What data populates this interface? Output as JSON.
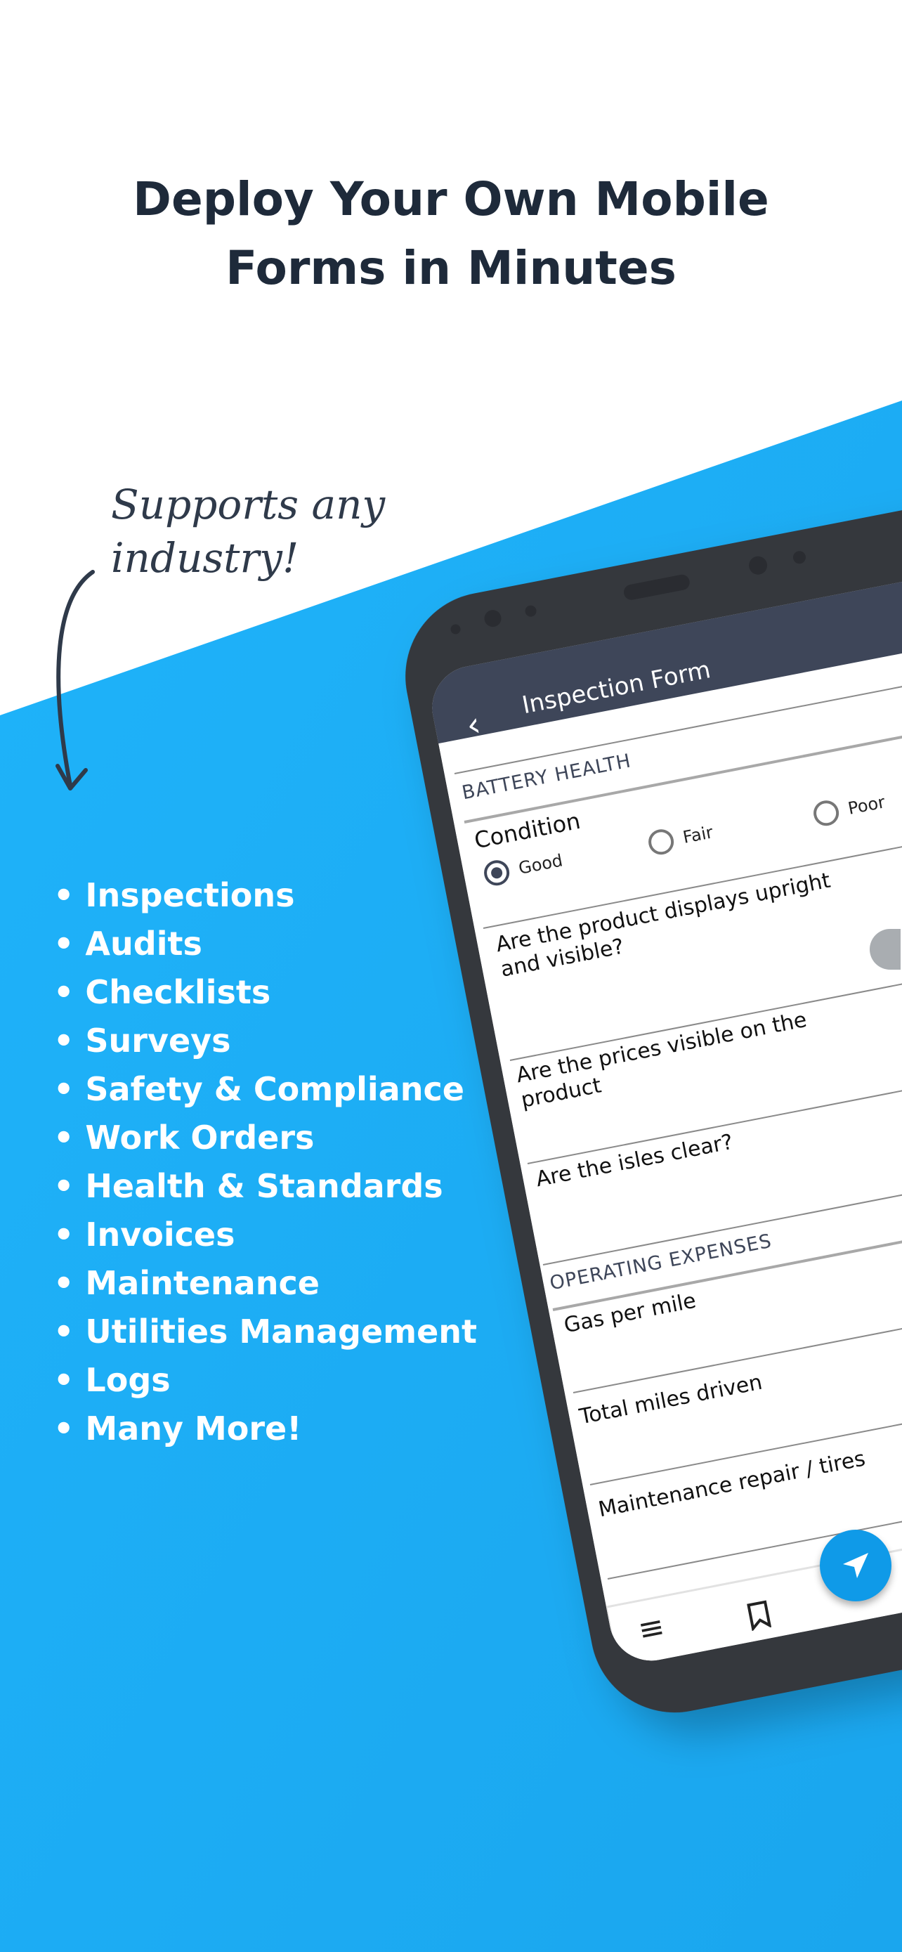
{
  "colors": {
    "accent_blue": "#1fb0f8",
    "headline": "#1e2a3a",
    "app_bar": "#3e4659",
    "fab": "#0f9ae8"
  },
  "headline": {
    "line1": "Deploy Your Own Mobile",
    "line2": "Forms in Minutes"
  },
  "callout": {
    "line1": "Supports any",
    "line2": "industry!"
  },
  "industries": [
    "• Inspections",
    "• Audits",
    "• Checklists",
    "• Surveys",
    "• Safety & Compliance",
    "• Work Orders",
    "• Health & Standards",
    "• Invoices",
    "• Maintenance",
    "• Utilities Management",
    "• Logs",
    "• Many More!"
  ],
  "app": {
    "title": "Inspection Form",
    "back_icon": "chevron-left-icon",
    "sections": [
      {
        "title": "BATTERY HEALTH"
      },
      {
        "title": "OPERATING EXPENSES"
      }
    ],
    "condition": {
      "label": "Condition",
      "options": [
        "Good",
        "Fair",
        "Poor"
      ],
      "selected": "Good"
    },
    "questions": [
      "Are the product displays upright and visible?",
      "Are the prices visible on the product",
      "Are the isles clear?"
    ],
    "expense_fields": [
      "Gas per mile",
      "Total miles driven",
      "Maintenance repair / tires"
    ],
    "nav_icons": [
      "menu-icon",
      "bookmark-icon"
    ],
    "fab_icon": "send-icon"
  }
}
